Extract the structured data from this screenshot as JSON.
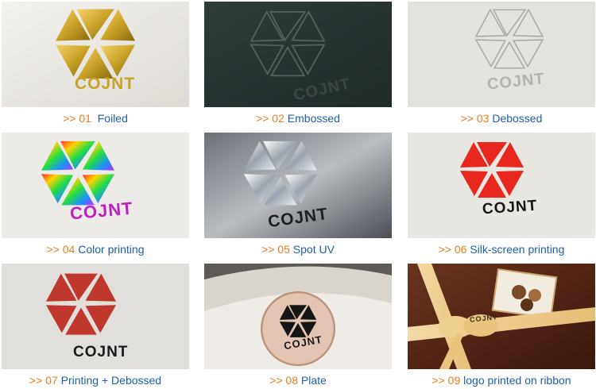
{
  "brand_text": "COJNT",
  "items": [
    {
      "num": ">> 01",
      "label": "Foiled"
    },
    {
      "num": ">> 02",
      "label": "Embossed"
    },
    {
      "num": ">> 03",
      "label": "Debossed"
    },
    {
      "num": ">> 04",
      "label": "Color printing"
    },
    {
      "num": ">> 05",
      "label": "Spot UV"
    },
    {
      "num": ">> 06",
      "label": "Silk-screen printing"
    },
    {
      "num": ">> 07",
      "label": "Printing + Debossed"
    },
    {
      "num": ">> 08",
      "label": "Plate"
    },
    {
      "num": ">> 09",
      "label": "logo printed on ribbon"
    }
  ],
  "colors": {
    "number_accent": "#e67e22",
    "label_blue": "#1f5fa8"
  }
}
